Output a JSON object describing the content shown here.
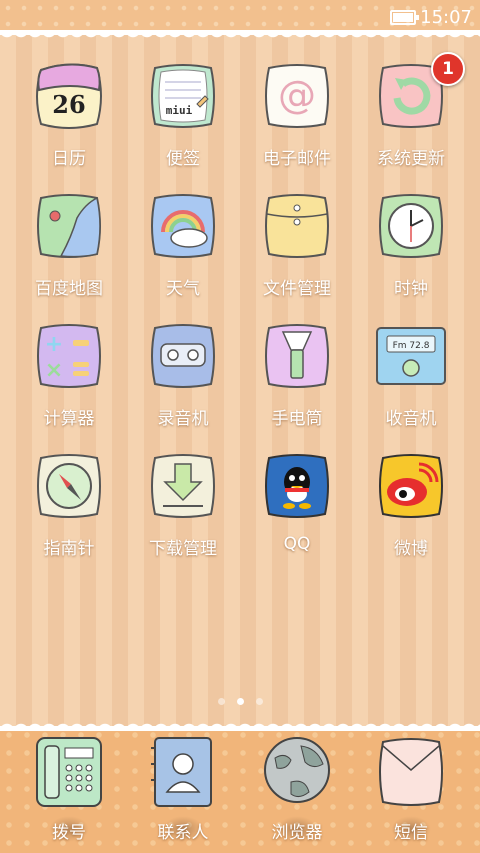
{
  "status_bar": {
    "time": "15:07"
  },
  "apps": [
    {
      "label": "日历",
      "icon": "calendar-icon",
      "day": "26"
    },
    {
      "label": "便签",
      "icon": "notes-icon",
      "brand": "miui"
    },
    {
      "label": "电子邮件",
      "icon": "email-icon"
    },
    {
      "label": "系统更新",
      "icon": "update-icon",
      "badge": "1"
    },
    {
      "label": "百度地图",
      "icon": "map-icon"
    },
    {
      "label": "天气",
      "icon": "weather-icon"
    },
    {
      "label": "文件管理",
      "icon": "folder-icon"
    },
    {
      "label": "时钟",
      "icon": "clock-icon"
    },
    {
      "label": "计算器",
      "icon": "calculator-icon"
    },
    {
      "label": "录音机",
      "icon": "recorder-icon"
    },
    {
      "label": "手电筒",
      "icon": "flashlight-icon"
    },
    {
      "label": "收音机",
      "icon": "radio-icon",
      "freq": "Fm 72.8"
    },
    {
      "label": "指南针",
      "icon": "compass-icon"
    },
    {
      "label": "下载管理",
      "icon": "download-icon"
    },
    {
      "label": "QQ",
      "icon": "qq-icon"
    },
    {
      "label": "微博",
      "icon": "weibo-icon"
    }
  ],
  "page_indicator": {
    "count": 3,
    "active": 1
  },
  "dock": [
    {
      "label": "拨号",
      "icon": "phone-icon"
    },
    {
      "label": "联系人",
      "icon": "contacts-icon"
    },
    {
      "label": "浏览器",
      "icon": "browser-icon"
    },
    {
      "label": "短信",
      "icon": "message-icon"
    }
  ]
}
